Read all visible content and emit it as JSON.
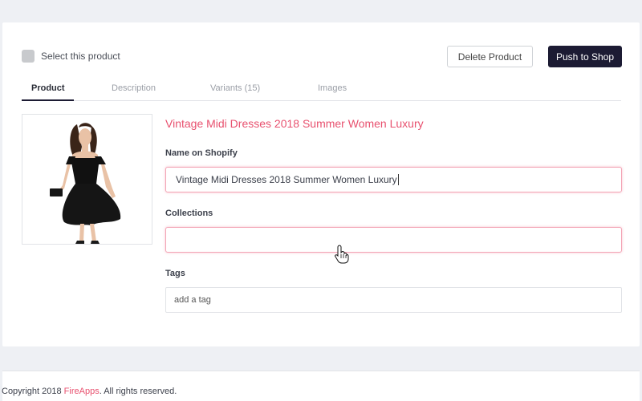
{
  "header": {
    "select_label": "Select this product",
    "delete_label": "Delete Product",
    "push_label": "Push to Shop"
  },
  "tabs": [
    {
      "label": "Product",
      "active": true
    },
    {
      "label": "Description",
      "active": false
    },
    {
      "label": "Variants (15)",
      "active": false
    },
    {
      "label": "Images",
      "active": false
    }
  ],
  "product": {
    "title": "Vintage Midi Dresses 2018 Summer Women Luxury",
    "image_icon": "dress-photo"
  },
  "form": {
    "name_label": "Name on Shopify",
    "name_value": "Vintage Midi Dresses 2018 Summer Women Luxury",
    "collections_label": "Collections",
    "collections_value": "",
    "tags_label": "Tags",
    "tags_placeholder": "add a tag"
  },
  "footer": {
    "prefix": "Copyright 2018 ",
    "brand": "FireApps",
    "suffix": ". All rights reserved."
  },
  "colors": {
    "accent": "#e8516f",
    "primary_dark": "#1c1b33",
    "background": "#eef0f4"
  },
  "cursor_icon": "hand-pointer-icon"
}
